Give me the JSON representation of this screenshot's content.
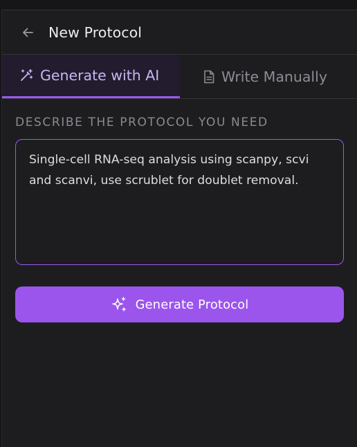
{
  "header": {
    "title": "New Protocol",
    "back_icon": "arrow-left-icon"
  },
  "tabs": [
    {
      "label": "Generate with AI",
      "icon": "magic-wand-icon",
      "active": true
    },
    {
      "label": "Write Manually",
      "icon": "document-icon",
      "active": false
    }
  ],
  "form": {
    "section_label": "DESCRIBE THE PROTOCOL YOU NEED",
    "description_value": "Single-cell RNA-seq analysis using scanpy, scvi and scanvi, use scrublet for doublet removal."
  },
  "actions": {
    "generate_label": "Generate Protocol",
    "generate_icon": "sparkles-icon"
  },
  "colors": {
    "accent": "#9b55ec",
    "active_tab_text": "#c9b5f2",
    "background": "#1d1d20"
  }
}
